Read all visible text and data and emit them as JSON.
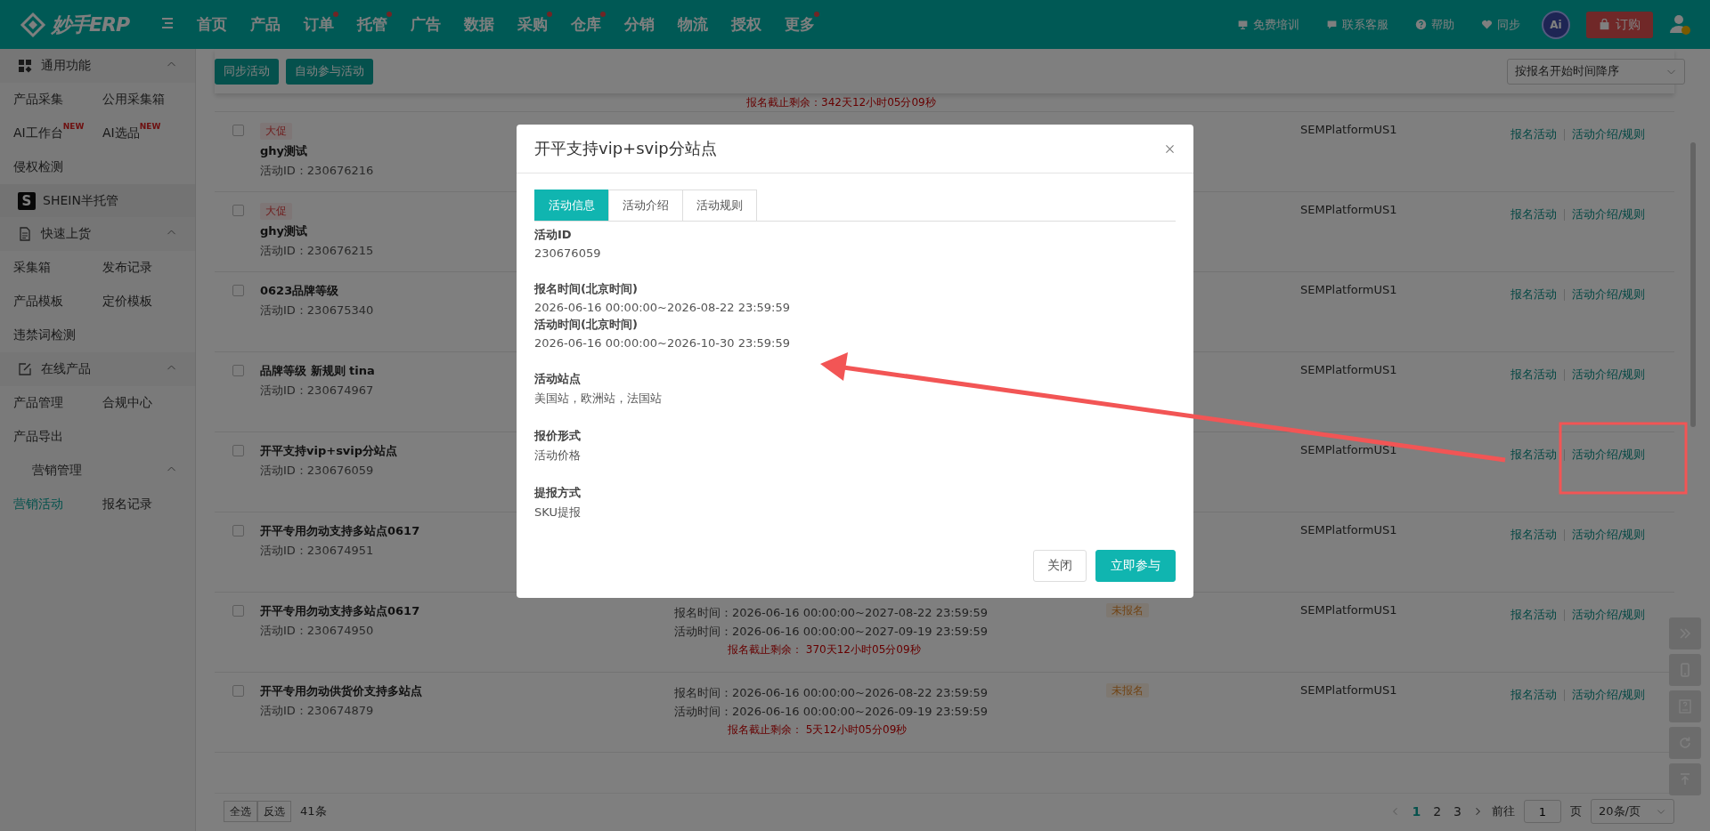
{
  "header": {
    "logo": "妙手ERP",
    "nav": [
      {
        "label": "首页",
        "dot": false
      },
      {
        "label": "产品",
        "dot": false
      },
      {
        "label": "订单",
        "dot": true
      },
      {
        "label": "托管",
        "dot": true
      },
      {
        "label": "广告",
        "dot": false
      },
      {
        "label": "数据",
        "dot": false
      },
      {
        "label": "采购",
        "dot": true
      },
      {
        "label": "仓库",
        "dot": true
      },
      {
        "label": "分销",
        "dot": false
      },
      {
        "label": "物流",
        "dot": false
      },
      {
        "label": "授权",
        "dot": false
      },
      {
        "label": "更多",
        "dot": true
      }
    ],
    "links": [
      {
        "label": "免费培训",
        "kind": "training"
      },
      {
        "label": "联系客服",
        "kind": "chat"
      },
      {
        "label": "帮助",
        "kind": "help"
      },
      {
        "label": "同步",
        "kind": "sync"
      }
    ],
    "ai_badge": "Ai",
    "order_button": "订购"
  },
  "sidebar": [
    {
      "title": "通用功能",
      "kind": "grid",
      "expanded": true,
      "items": [
        {
          "label": "产品采集",
          "selected": false
        },
        {
          "label": "公用采集箱",
          "selected": false
        },
        {
          "label": "AI工作台",
          "new": "NEW",
          "selected": false
        },
        {
          "label": "AI选品",
          "new": "NEW",
          "selected": false
        },
        {
          "label": "侵权检测",
          "selected": false
        }
      ]
    },
    {
      "title": "SHEIN半托管",
      "kind": "shein",
      "logo": "S"
    },
    {
      "title": "快速上货",
      "kind": "doc",
      "expanded": true,
      "items": [
        {
          "label": "采集箱",
          "selected": false
        },
        {
          "label": "发布记录",
          "selected": false
        },
        {
          "label": "产品模板",
          "selected": false
        },
        {
          "label": "定价模板",
          "selected": false
        },
        {
          "label": "违禁词检测",
          "selected": false
        }
      ]
    },
    {
      "title": "在线产品",
      "kind": "edit",
      "expanded": true,
      "items": [
        {
          "label": "产品管理",
          "selected": false
        },
        {
          "label": "合规中心",
          "selected": false
        },
        {
          "label": "产品导出",
          "selected": false
        }
      ]
    },
    {
      "title": "营销管理",
      "kind": "none",
      "expanded": true,
      "items": [
        {
          "label": "营销活动",
          "selected": true
        },
        {
          "label": "报名记录",
          "selected": false
        }
      ]
    }
  ],
  "toolbar": {
    "buttons": [
      "同步活动",
      "自动参与活动"
    ],
    "sort": "按报名开始时间降序"
  },
  "partial_deadline": {
    "label": "报名截止剩余：",
    "value": "342天12小时05分09秒"
  },
  "rows": [
    {
      "checked": false,
      "tag": "大促",
      "title": "ghy测试",
      "id_text": "活动ID：230676216",
      "store": "SEMPlatformUS1",
      "actions": [
        "报名活动",
        "活动介绍/规则"
      ]
    },
    {
      "checked": false,
      "tag": "大促",
      "title": "ghy测试",
      "id_text": "活动ID：230676215",
      "store": "SEMPlatformUS1",
      "actions": [
        "报名活动",
        "活动介绍/规则"
      ]
    },
    {
      "checked": false,
      "title": "0623品牌等级",
      "id_text": "活动ID：230675340",
      "store": "SEMPlatformUS1",
      "actions": [
        "报名活动",
        "活动介绍/规则"
      ]
    },
    {
      "checked": false,
      "title": "品牌等级 新规则 tina",
      "id_text": "活动ID：230674967",
      "store": "SEMPlatformUS1",
      "actions": [
        "报名活动",
        "活动介绍/规则"
      ]
    },
    {
      "checked": false,
      "title": "开平支持vip+svip分站点",
      "id_text": "活动ID：230676059",
      "store": "SEMPlatformUS1",
      "actions": [
        "报名活动",
        "活动介绍/规则"
      ]
    },
    {
      "checked": false,
      "title": "开平专用勿动支持多站点0617",
      "id_text": "活动ID：230674951",
      "store": "SEMPlatformUS1",
      "actions": [
        "报名活动",
        "活动介绍/规则"
      ]
    },
    {
      "checked": false,
      "title": "开平专用勿动支持多站点0617",
      "id_text": "活动ID：230674950",
      "times": [
        "报名时间：2026-06-16 00:00:00~2027-08-22 23:59:59",
        "活动时间：2026-06-16 00:00:00~2027-09-19 23:59:59"
      ],
      "deadline_label": "报名截止剩余：",
      "deadline": "370天12小时05分09秒",
      "status": "未报名",
      "store": "SEMPlatformUS1",
      "actions": [
        "报名活动",
        "活动介绍/规则"
      ]
    },
    {
      "checked": false,
      "title": "开平专用勿动供货价支持多站点",
      "id_text": "活动ID：230674879",
      "times": [
        "报名时间：2026-06-16 00:00:00~2026-08-22 23:59:59",
        "活动时间：2026-06-16 00:00:00~2026-09-19 23:59:59"
      ],
      "deadline_label": "报名截止剩余：",
      "deadline": "5天12小时05分09秒",
      "status": "未报名",
      "store": "SEMPlatformUS1",
      "actions": [
        "报名活动",
        "活动介绍/规则"
      ]
    }
  ],
  "footer": {
    "buttons": [
      "全选",
      "反选"
    ],
    "count": "41条",
    "pages": [
      {
        "label": "1",
        "selected": true
      },
      {
        "label": "2",
        "selected": false
      },
      {
        "label": "3",
        "selected": false
      }
    ],
    "goto_label": "前往",
    "goto_value": "1",
    "page_unit": "页",
    "page_size": "20条/页"
  },
  "float_tools": [
    {
      "kind": "expand"
    },
    {
      "kind": "phone"
    },
    {
      "kind": "help"
    },
    {
      "kind": "refresh"
    },
    {
      "kind": "top"
    }
  ],
  "modal": {
    "title": "开平支持vip+svip分站点",
    "tabs": [
      {
        "label": "活动信息",
        "selected": true
      },
      {
        "label": "活动介绍",
        "selected": false
      },
      {
        "label": "活动规则",
        "selected": false
      }
    ],
    "groups": [
      [
        {
          "label": "活动ID",
          "value": "230676059"
        }
      ],
      [
        {
          "label": "报名时间(北京时间)",
          "value": "2026-06-16 00:00:00~2026-08-22 23:59:59"
        },
        {
          "label": "活动时间(北京时间)",
          "value": "2026-06-16 00:00:00~2026-10-30 23:59:59"
        }
      ],
      [
        {
          "label": "活动站点",
          "value": "美国站，欧洲站，法国站"
        }
      ],
      [
        {
          "label": "报价形式",
          "value": "活动价格"
        }
      ],
      [
        {
          "label": "提报方式",
          "value": "SKU提报"
        }
      ]
    ],
    "buttons": [
      {
        "label": "关闭",
        "kind": "default"
      },
      {
        "label": "立即参与",
        "kind": "primary"
      }
    ]
  }
}
